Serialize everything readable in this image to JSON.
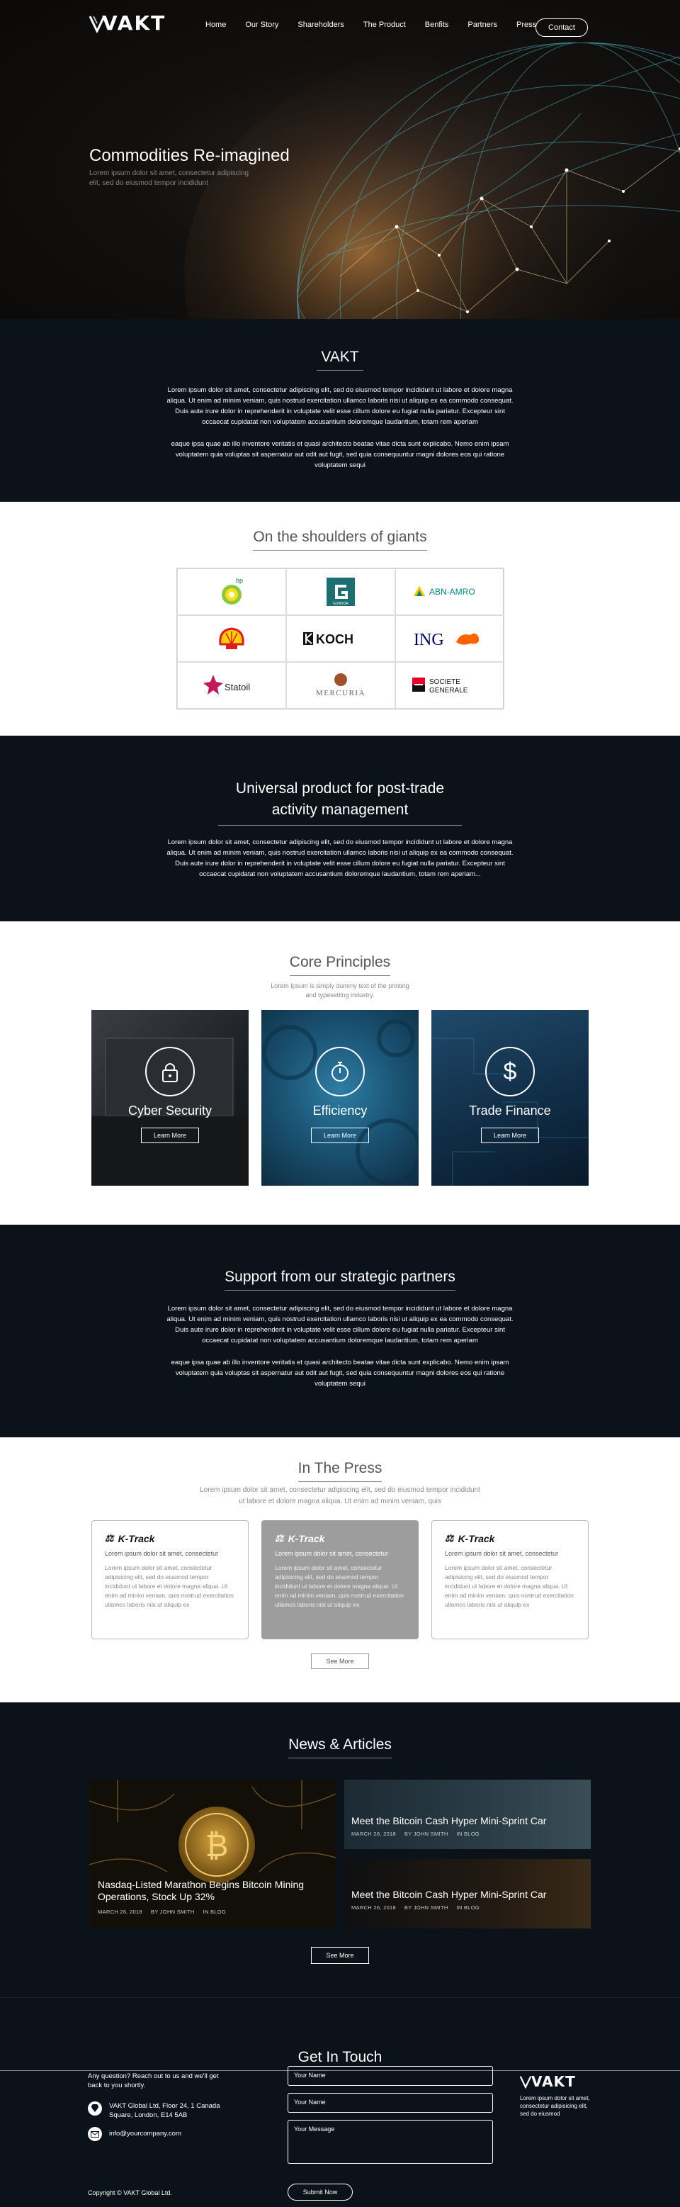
{
  "nav": {
    "logo": "VAKT",
    "links": [
      "Home",
      "Our Story",
      "Shareholders",
      "The Product",
      "Benfits",
      "Partners",
      "Press"
    ],
    "contact": "Contact"
  },
  "hero": {
    "title": "Commodities Re-imagined",
    "subtitle": "Lorem ipsum dolor sit amet, consectetur adipiscing elit, sed do eiusmod tempor incididunt"
  },
  "vakt": {
    "title": "VAKT",
    "para1": "Lorem ipsum dolor sit amet, consectetur adipiscing elit, sed do eiusmod tempor incididunt ut labore et dolore magna aliqua. Ut enim ad minim veniam, quis nostrud exercitation ullamco laboris nisi ut aliquip ex ea commodo consequat. Duis aute irure dolor in reprehenderit in voluptate velit esse cillum dolore eu fugiat nulla pariatur. Excepteur sint occaecat cupidatat non voluptatem accusantium doloremque laudantium, totam rem aperiam",
    "para2": "eaque ipsa quae ab illo inventore veritatis et quasi architecto beatae vitae dicta sunt explicabo. Nemo enim ipsam voluptatem quia voluptas sit aspernatur aut odit aut fugit, sed quia consequuntur magni dolores eos qui ratione voluptatem sequi"
  },
  "giants": {
    "title": "On the shoulders of giants",
    "logos": [
      "bp",
      "GUNVOR",
      "ABN·AMRO",
      "Shell",
      "KOCH",
      "ING",
      "Statoil",
      "MERCURIA",
      "SOCIETE GENERALE"
    ]
  },
  "universal": {
    "title_line1": "Universal product for post-trade",
    "title_line2": "activity management",
    "para": "Lorem ipsum dolor sit amet, consectetur adipiscing elit, sed do eiusmod tempor incididunt ut labore et dolore magna aliqua. Ut enim ad minim veniam, quis nostrud exercitation ullamco laboris nisi ut aliquip ex ea commodo consequat. Duis aute irure dolor in reprehenderit in voluptate velit esse cillum dolore eu fugiat nulla pariatur. Excepteur sint occaecat cupidatat non voluptatem accusantium doloremque laudantium, totam rem aperiam..."
  },
  "core": {
    "title": "Core Principles",
    "subtitle_line1": "Lorem Ipsum is simply dummy text of the printing",
    "subtitle_line2": "and typesetting industry.",
    "cards": [
      {
        "label": "Cyber Security",
        "button": "Learn More"
      },
      {
        "label": "Efficiency",
        "button": "Learn More"
      },
      {
        "label": "Trade Finance",
        "button": "Learn More"
      }
    ]
  },
  "support": {
    "title": "Support from our strategic partners",
    "para1": "Lorem ipsum dolor sit amet, consectetur adipiscing elit, sed do eiusmod tempor incididunt ut labore et dolore magna aliqua. Ut enim ad minim veniam, quis nostrud exercitation ullamco laboris nisi ut aliquip ex ea commodo consequat. Duis aute irure dolor in reprehenderit in voluptate velit esse cillum dolore eu fugiat nulla pariatur. Excepteur sint occaecat cupidatat non voluptatem accusantium doloremque laudantium, totam rem aperiam",
    "para2": "eaque ipsa quae ab illo inventore veritatis et quasi architecto beatae vitae dicta sunt explicabo. Nemo enim ipsam voluptatem quia voluptas sit aspernatur aut odit aut fugit, sed quia consequuntur magni dolores eos qui ratione voluptatem sequi"
  },
  "press": {
    "title": "In The Press",
    "subtitle_line1": "Lorem ipsum dolor sit amet, consectetur adipiscing elit, sed do eiusmod tempor incididunt",
    "subtitle_line2": "ut labore et dolore magna aliqua. Ut enim ad minim veniam, quis",
    "cards": [
      {
        "brand": "K-Track",
        "headline": "Lorem ipsum dolor sit amet, consectetur",
        "body": "Lorem ipsum dolor sit amet, consectetur adipisicing elit, sed do eiusmod tempor incididunt ut labore et dolore magna aliqua. Ut enim ad minim veniam, quis nostrud exercitation ullamco laboris nisi ut aliquip ex"
      },
      {
        "brand": "K-Track",
        "headline": "Lorem ipsum dolor sit amet, consectetur",
        "body": "Lorem ipsum dolor sit amet, consectetur adipisicing elit, sed do eiusmod tempor incididunt ut labore et dolore magna aliqua. Ut enim ad minim veniam, quis nostrud exercitation ullamco laboris nisi ut aliquip ex"
      },
      {
        "brand": "K-Track",
        "headline": "Lorem ipsum dolor sit amet, consectetur",
        "body": "Lorem ipsum dolor sit amet, consectetur adipisicing elit, sed do eiusmod tempor incididunt ut labore et dolore magna aliqua. Ut enim ad minim veniam, quis nostrud exercitation ullamco laboris nisi ut aliquip ex"
      }
    ],
    "see_more": "See More"
  },
  "news": {
    "title": "News & Articles",
    "big": {
      "title": "Nasdaq-Listed Marathon Begins Bitcoin Mining Operations, Stock Up 32%",
      "date": "MARCH 26, 2018",
      "author": "BY JOHN SMITH",
      "category": "IN BLOG"
    },
    "small": [
      {
        "title": "Meet the Bitcoin Cash Hyper Mini-Sprint Car",
        "date": "MARCH 26, 2018",
        "author": "BY JOHN SMITH",
        "category": "IN BLOG"
      },
      {
        "title": "Meet the Bitcoin Cash Hyper Mini-Sprint Car",
        "date": "MARCH 26, 2018",
        "author": "BY JOHN SMITH",
        "category": "IN BLOG"
      }
    ],
    "see_more": "See More"
  },
  "contact": {
    "title": "Get In Touch",
    "intro": "Any question? Reach out to us and we'll get back to you shortly.",
    "address": "VAKT Global Ltd, Floor 24, 1 Canada Square, London, E14 5AB",
    "email": "info@yourcompany.com",
    "fields": {
      "name1": "Your Name",
      "name2": "Your Name",
      "message": "Your Message"
    },
    "submit": "Submit Now",
    "logo": "VAKT",
    "logo_text": "Lorem ipsum dolor sit amet, consectetur adipisicing elit, sed do eiusmod",
    "copyright": "Copyright © VAKT Global Ltd."
  }
}
